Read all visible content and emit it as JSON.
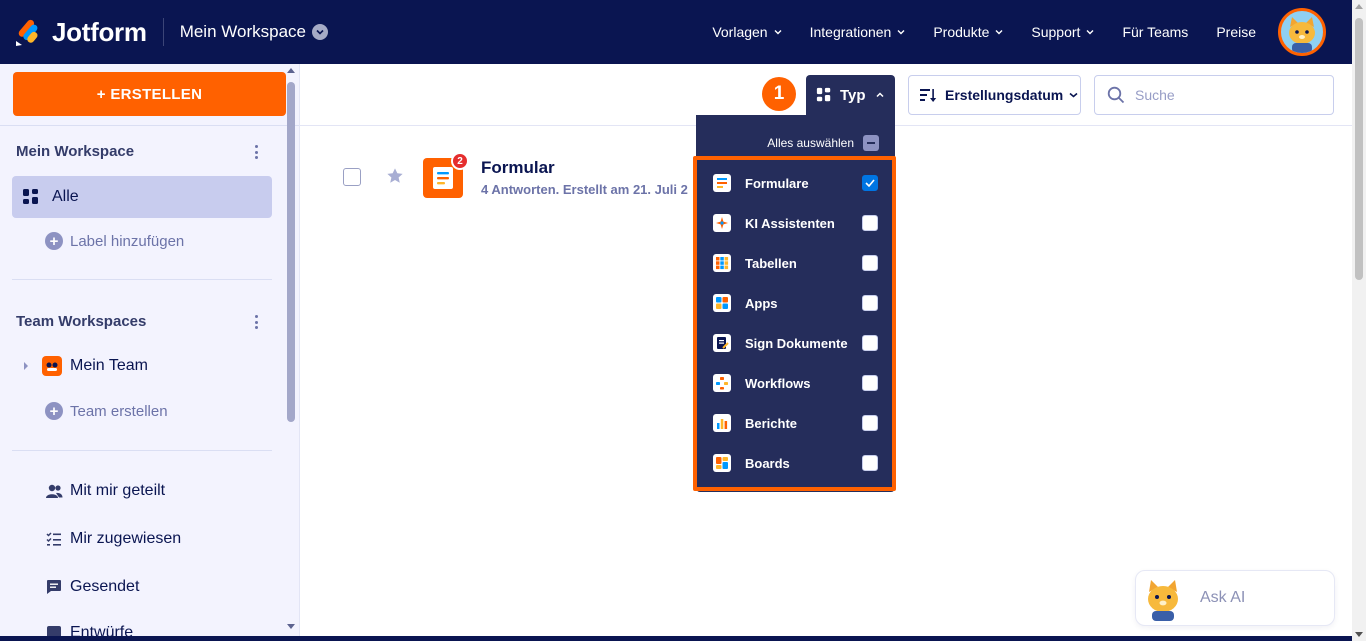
{
  "header": {
    "brand": "Jotform",
    "workspace": "Mein Workspace",
    "nav": [
      {
        "label": "Vorlagen",
        "has_menu": true
      },
      {
        "label": "Integrationen",
        "has_menu": true
      },
      {
        "label": "Produkte",
        "has_menu": true
      },
      {
        "label": "Support",
        "has_menu": true
      },
      {
        "label": "Für Teams",
        "has_menu": false
      },
      {
        "label": "Preise",
        "has_menu": false
      }
    ]
  },
  "sidebar": {
    "create_label": "+ ERSTELLEN",
    "my_workspace_title": "Mein Workspace",
    "all_label": "Alle",
    "add_label": "Label hinzufügen",
    "team_workspaces_title": "Team Workspaces",
    "team_name": "Mein Team",
    "create_team": "Team erstellen",
    "links": [
      {
        "label": "Mit mir geteilt",
        "icon": "users-icon"
      },
      {
        "label": "Mir zugewiesen",
        "icon": "checklist-icon"
      },
      {
        "label": "Gesendet",
        "icon": "message-icon"
      },
      {
        "label": "Entwürfe",
        "icon": "draft-icon"
      }
    ]
  },
  "toolbar": {
    "step_number": "1",
    "type_label": "Typ",
    "sort_label": "Erstellungsdatum",
    "search_placeholder": "Suche"
  },
  "form": {
    "title": "Formular",
    "badge": "2",
    "subtitle": "4 Antworten. Erstellt am 21. Juli 2"
  },
  "type_dropdown": {
    "select_all": "Alles auswählen",
    "items": [
      {
        "label": "Formulare",
        "checked": true,
        "icon": "form-icon"
      },
      {
        "label": "KI Assistenten",
        "checked": false,
        "icon": "ai-agent-icon"
      },
      {
        "label": "Tabellen",
        "checked": false,
        "icon": "table-icon"
      },
      {
        "label": "Apps",
        "checked": false,
        "icon": "apps-icon"
      },
      {
        "label": "Sign Dokumente",
        "checked": false,
        "icon": "sign-document-icon"
      },
      {
        "label": "Workflows",
        "checked": false,
        "icon": "workflow-icon"
      },
      {
        "label": "Berichte",
        "checked": false,
        "icon": "report-icon"
      },
      {
        "label": "Boards",
        "checked": false,
        "icon": "board-icon"
      }
    ]
  },
  "ask_ai": "Ask AI",
  "colors": {
    "navy": "#0a1551",
    "orange": "#ff6100",
    "dropdown_bg": "#252d5b",
    "checkbox_blue": "#0075e3",
    "sidebar_bg": "#f3f3fe"
  }
}
